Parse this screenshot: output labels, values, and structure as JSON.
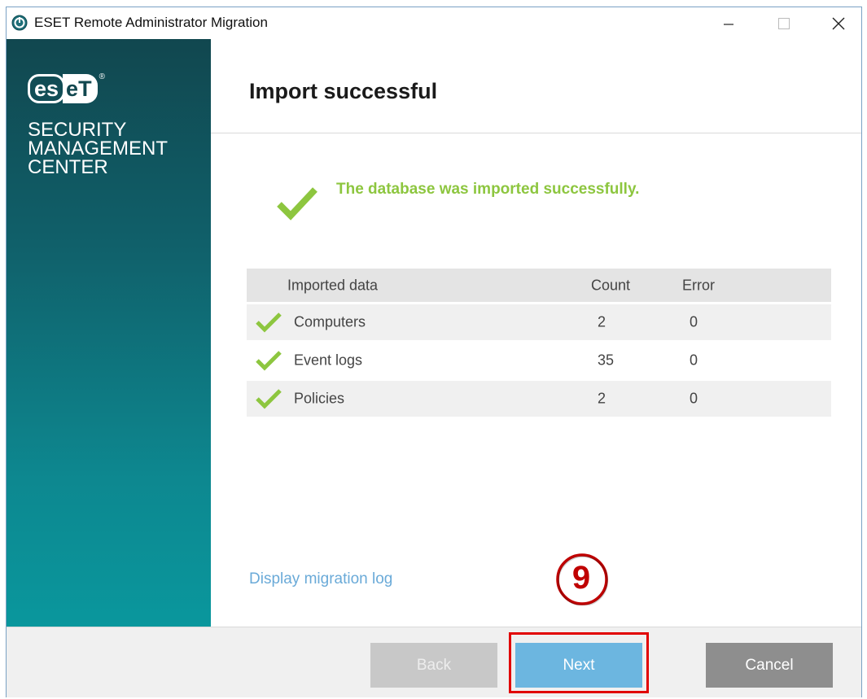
{
  "window": {
    "title": "ESET Remote Administrator Migration",
    "icon": "eset-app-icon",
    "controls": [
      "minimize-icon",
      "maximize-icon",
      "close-icon"
    ]
  },
  "sidebar": {
    "logo_text_es": "es",
    "logo_text_et": "eT",
    "logo_reg": "®",
    "product_line1": "SECURITY",
    "product_line2": "MANAGEMENT",
    "product_line3": "CENTER"
  },
  "header": {
    "title": "Import successful"
  },
  "status": {
    "message": "The database was imported successfully."
  },
  "table": {
    "headers": {
      "name": "Imported data",
      "count": "Count",
      "error": "Error"
    },
    "rows": [
      {
        "name": "Computers",
        "count": "2",
        "error": "0"
      },
      {
        "name": "Event logs",
        "count": "35",
        "error": "0"
      },
      {
        "name": "Policies",
        "count": "2",
        "error": "0"
      }
    ]
  },
  "links": {
    "migration_log": "Display migration log"
  },
  "annotation": {
    "step": "9"
  },
  "buttons": {
    "back": "Back",
    "next": "Next",
    "cancel": "Cancel"
  },
  "colors": {
    "accent_green": "#8dc63f",
    "link_blue": "#6aaad8",
    "next_blue": "#6cb6e0",
    "highlight_red": "#e10000",
    "sidebar_top": "#11474f",
    "sidebar_bottom": "#0a979d"
  }
}
